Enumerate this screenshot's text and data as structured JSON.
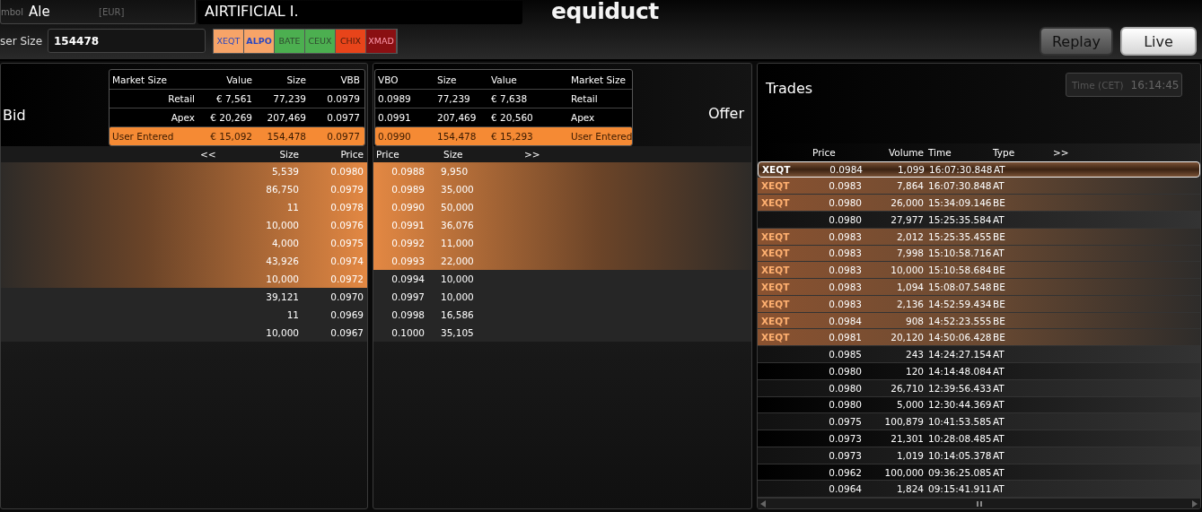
{
  "header": {
    "symbol": {
      "label": "mbol",
      "value": "Ale",
      "currency": "[EUR]"
    },
    "name": "AIRTIFICIAL I.",
    "logo": "equiduct",
    "user_size": {
      "label": "ser Size",
      "value": "154478"
    },
    "venues": [
      {
        "label": "XEQT",
        "color": "#f7a468",
        "selected": false
      },
      {
        "label": "ALPO",
        "color": "#f7a468",
        "selected": true
      },
      {
        "label": "BATE",
        "color": "#4caf50",
        "selected": false
      },
      {
        "label": "CEUX",
        "color": "#4caf50",
        "selected": false
      },
      {
        "label": "CHIX",
        "color": "#e8441a",
        "selected": false
      },
      {
        "label": "XMAD",
        "color": "#8a0f12",
        "selected": false
      }
    ],
    "modes": [
      {
        "label": "Replay",
        "selected": false
      },
      {
        "label": "Live",
        "selected": true
      }
    ]
  },
  "bid": {
    "title": "Bid",
    "summary_columns": [
      "Market Size",
      "Value",
      "Size",
      "VBB"
    ],
    "summary_rows": [
      {
        "cells": [
          "Retail",
          "€ 7,561",
          "77,239",
          "0.0979"
        ],
        "highlighted": false
      },
      {
        "cells": [
          "Apex",
          "€ 20,269",
          "207,469",
          "0.0977"
        ],
        "highlighted": false
      },
      {
        "cells": [
          "User Entered",
          "€ 15,092",
          "154,478",
          "0.0977"
        ],
        "highlighted": true
      }
    ],
    "columns": [
      "<<",
      "Size",
      "Price"
    ],
    "rows": [
      {
        "size": "5,539",
        "price": "0.0980",
        "highlighted": true
      },
      {
        "size": "86,750",
        "price": "0.0979",
        "highlighted": true
      },
      {
        "size": "11",
        "price": "0.0978",
        "highlighted": true
      },
      {
        "size": "10,000",
        "price": "0.0976",
        "highlighted": true
      },
      {
        "size": "4,000",
        "price": "0.0975",
        "highlighted": true
      },
      {
        "size": "43,926",
        "price": "0.0974",
        "highlighted": true
      },
      {
        "size": "10,000",
        "price": "0.0972",
        "highlighted": true
      },
      {
        "size": "39,121",
        "price": "0.0970",
        "highlighted": false
      },
      {
        "size": "11",
        "price": "0.0969",
        "highlighted": false
      },
      {
        "size": "10,000",
        "price": "0.0967",
        "highlighted": false
      }
    ]
  },
  "offer": {
    "title": "Offer",
    "summary_columns": [
      "VBO",
      "Size",
      "Value",
      "Market Size"
    ],
    "summary_rows": [
      {
        "cells": [
          "0.0989",
          "77,239",
          "€ 7,638",
          "Retail"
        ],
        "highlighted": false
      },
      {
        "cells": [
          "0.0991",
          "207,469",
          "€ 20,560",
          "Apex"
        ],
        "highlighted": false
      },
      {
        "cells": [
          "0.0990",
          "154,478",
          "€ 15,293",
          "User Entered"
        ],
        "highlighted": true
      }
    ],
    "columns": [
      "Price",
      "Size",
      ">>"
    ],
    "rows": [
      {
        "price": "0.0988",
        "size": "9,950",
        "highlighted": true
      },
      {
        "price": "0.0989",
        "size": "35,000",
        "highlighted": true
      },
      {
        "price": "0.0990",
        "size": "50,000",
        "highlighted": true
      },
      {
        "price": "0.0991",
        "size": "36,076",
        "highlighted": true
      },
      {
        "price": "0.0992",
        "size": "11,000",
        "highlighted": true
      },
      {
        "price": "0.0993",
        "size": "22,000",
        "highlighted": true
      },
      {
        "price": "0.0994",
        "size": "10,000",
        "highlighted": false
      },
      {
        "price": "0.0997",
        "size": "10,000",
        "highlighted": false
      },
      {
        "price": "0.0998",
        "size": "16,586",
        "highlighted": false
      },
      {
        "price": "0.1000",
        "size": "35,105",
        "highlighted": false
      }
    ]
  },
  "trades": {
    "title": "Trades",
    "time_label": "Time (CET)",
    "time": "16:14:45",
    "columns": [
      "Price",
      "Volume",
      "Time",
      "Type",
      ">>"
    ],
    "rows": [
      {
        "venue": "XEQT",
        "price": "0.0984",
        "volume": "1,099",
        "time": "16:07:30.848",
        "type": "AT",
        "highlighted": true,
        "selected": true
      },
      {
        "venue": "XEQT",
        "price": "0.0983",
        "volume": "7,864",
        "time": "16:07:30.848",
        "type": "AT",
        "highlighted": true,
        "selected": false
      },
      {
        "venue": "XEQT",
        "price": "0.0980",
        "volume": "26,000",
        "time": "15:34:09.146",
        "type": "BE",
        "highlighted": true,
        "selected": false
      },
      {
        "price": "0.0980",
        "volume": "27,977",
        "time": "15:25:35.584",
        "type": "AT",
        "highlighted": false,
        "selected": false
      },
      {
        "venue": "XEQT",
        "price": "0.0983",
        "volume": "2,012",
        "time": "15:25:35.455",
        "type": "BE",
        "highlighted": true,
        "selected": false
      },
      {
        "venue": "XEQT",
        "price": "0.0983",
        "volume": "7,998",
        "time": "15:10:58.716",
        "type": "AT",
        "highlighted": true,
        "selected": false
      },
      {
        "venue": "XEQT",
        "price": "0.0983",
        "volume": "10,000",
        "time": "15:10:58.684",
        "type": "BE",
        "highlighted": true,
        "selected": false
      },
      {
        "venue": "XEQT",
        "price": "0.0983",
        "volume": "1,094",
        "time": "15:08:07.548",
        "type": "BE",
        "highlighted": true,
        "selected": false
      },
      {
        "venue": "XEQT",
        "price": "0.0983",
        "volume": "2,136",
        "time": "14:52:59.434",
        "type": "BE",
        "highlighted": true,
        "selected": false
      },
      {
        "venue": "XEQT",
        "price": "0.0984",
        "volume": "908",
        "time": "14:52:23.555",
        "type": "BE",
        "highlighted": true,
        "selected": false
      },
      {
        "venue": "XEQT",
        "price": "0.0981",
        "volume": "20,120",
        "time": "14:50:06.428",
        "type": "BE",
        "highlighted": true,
        "selected": false
      },
      {
        "price": "0.0985",
        "volume": "243",
        "time": "14:24:27.154",
        "type": "AT",
        "highlighted": false,
        "selected": false
      },
      {
        "price": "0.0980",
        "volume": "120",
        "time": "14:14:48.084",
        "type": "AT",
        "highlighted": false,
        "selected": false
      },
      {
        "price": "0.0980",
        "volume": "26,710",
        "time": "12:39:56.433",
        "type": "AT",
        "highlighted": false,
        "selected": false
      },
      {
        "price": "0.0980",
        "volume": "5,000",
        "time": "12:30:44.369",
        "type": "AT",
        "highlighted": false,
        "selected": false
      },
      {
        "price": "0.0975",
        "volume": "100,879",
        "time": "10:41:53.585",
        "type": "AT",
        "highlighted": false,
        "selected": false
      },
      {
        "price": "0.0973",
        "volume": "21,301",
        "time": "10:28:08.485",
        "type": "AT",
        "highlighted": false,
        "selected": false
      },
      {
        "price": "0.0973",
        "volume": "1,019",
        "time": "10:14:05.378",
        "type": "AT",
        "highlighted": false,
        "selected": false
      },
      {
        "price": "0.0962",
        "volume": "100,000",
        "time": "09:36:25.085",
        "type": "AT",
        "highlighted": false,
        "selected": false
      },
      {
        "price": "0.0964",
        "volume": "1,824",
        "time": "09:15:41.911",
        "type": "AT",
        "highlighted": false,
        "selected": false
      }
    ]
  }
}
